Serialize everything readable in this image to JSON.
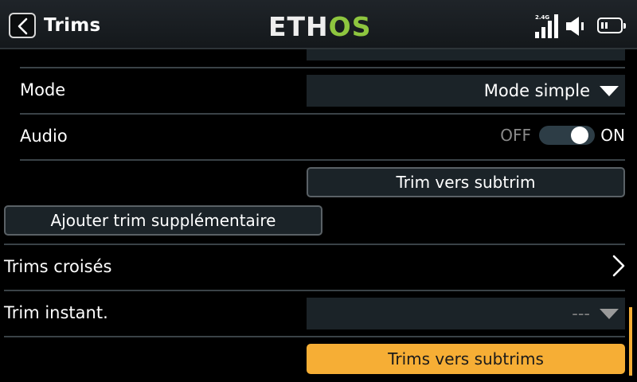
{
  "header": {
    "title": "Trims",
    "logo_part1": "ETH",
    "logo_part2": "OS",
    "signal_label": "2.4G"
  },
  "settings": {
    "mode_label": "Mode",
    "mode_value": "Mode simple",
    "audio_label": "Audio",
    "audio_off": "OFF",
    "audio_on": "ON",
    "audio_state": "ON",
    "trim_to_subtrim": "Trim vers subtrim",
    "add_extra_trim": "Ajouter trim supplémentaire",
    "cross_trims_label": "Trims croisés",
    "instant_trim_label": "Trim instant.",
    "instant_trim_value": "---",
    "trims_to_subtrims": "Trims vers subtrims"
  },
  "colors": {
    "accent": "#f6ae35",
    "logo_green": "#8ec63f",
    "field_bg": "#1b2328",
    "background": "#000000"
  },
  "icons": {
    "back": "chevron-left-icon",
    "signal": "signal-bars-icon",
    "volume": "speaker-icon",
    "battery": "battery-icon",
    "dropdown": "triangle-down-icon",
    "navigate": "chevron-right-icon"
  }
}
